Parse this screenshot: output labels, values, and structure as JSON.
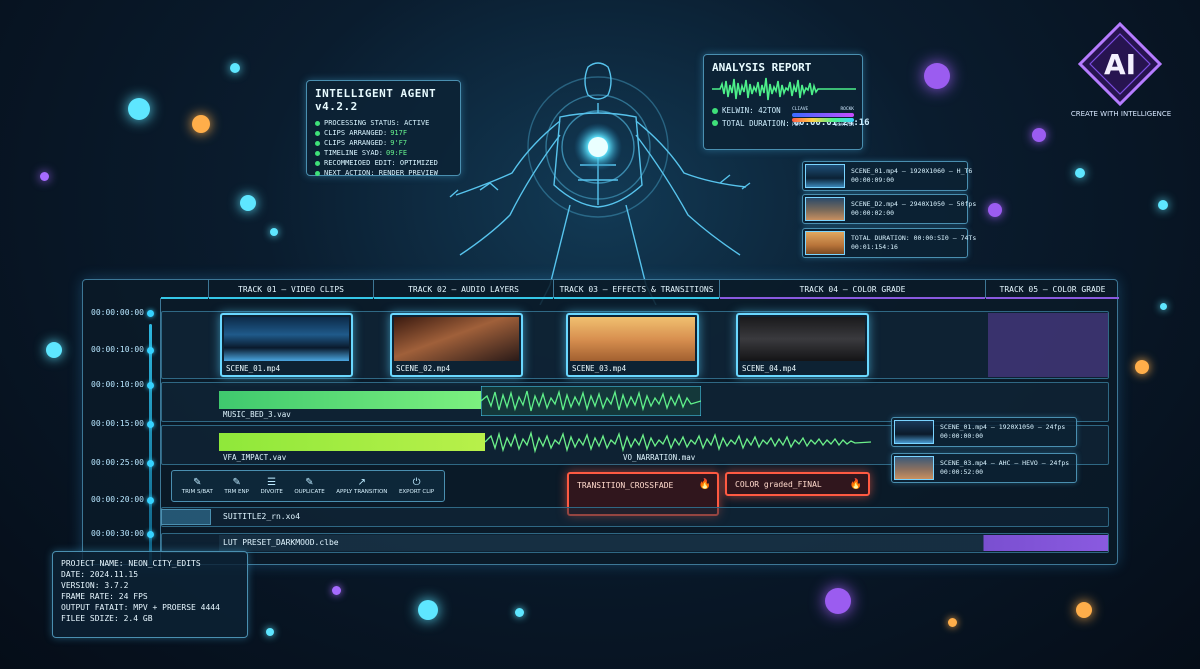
{
  "brand": {
    "logo_text": "AI",
    "tagline": "CREATE WITH INTELLIGENCE",
    "accent": "#9b5cf0"
  },
  "agent": {
    "title": "INTELLIGENT AGENT v4.2.2",
    "rows": [
      {
        "label": "PROCESSING STATUS: ACTIVE",
        "value": ""
      },
      {
        "label": "CLIPS ARRANGED:",
        "value": "917F"
      },
      {
        "label": "CLIPS ARRANGED:",
        "value": "9'F7"
      },
      {
        "label": "TIMELINE SYAD:",
        "value": "09:FE"
      },
      {
        "label": "RECOMMEIOED EDIT: OPTIMIZED",
        "value": ""
      },
      {
        "label": "NEXT ACTION: RENDER PREVIEW",
        "value": ""
      }
    ]
  },
  "analysis": {
    "title": "ANALYSIS REPORT",
    "meter_left": "CLIAVE",
    "meter_right": "ROCKK",
    "meter_left2": "PIM",
    "meter_right2": "DSATION",
    "kelvin": "KELWIN: 42TON",
    "duration_label": "TOTAL DURATION:",
    "duration_value": "00:00:01:24:16"
  },
  "side_clips": [
    {
      "line1": "SCENE_01.mp4 – 1920X1060 – H_T6",
      "line2": "00:00:09:00"
    },
    {
      "line1": "SCENE_D2.mp4 – 2940X1050 – 50fps",
      "line2": "00:00:02:00"
    },
    {
      "line1": "TOTAL DURATION: 00:00:SI0 – 74Ts",
      "line2": "00:01:154:16"
    }
  ],
  "right_clips": [
    {
      "line1": "SCENE_01.mp4 – 1920X1050 – 24fps",
      "line2": "00:00:00:00"
    },
    {
      "line1": "SCENE_03.mp4 – AHC – HEVO – 24fps",
      "line2": "00:00:52:00"
    }
  ],
  "tracks": {
    "headers": [
      "TRACK 01 – VIDEO CLIPS",
      "TRACK 02 – AUDIO LAYERS",
      "TRACK 03 – EFFECTS & TRANSITIONS",
      "TRACK 04 – COLOR GRADE",
      "TRACK 05 – COLOR GRADE"
    ]
  },
  "times": [
    "00:00:00:00",
    "00:00:10:00",
    "00:00:10:00",
    "00:00:15:00",
    "00:00:25:00",
    "00:00:20:00",
    "00:00:30:00"
  ],
  "video_clips": [
    "SCENE_01.mp4",
    "SCENE_02.mp4",
    "SCENE_03.mp4",
    "SCENE_04.mp4"
  ],
  "audio": {
    "music": "MUSIC_BED_3.vav",
    "sfx": "VFA_IMPACT.vav",
    "vo": "VO_NARRATION.mav"
  },
  "toolbar": [
    {
      "icon": "✎",
      "label": "TRIM S/BAT"
    },
    {
      "icon": "✎",
      "label": "TRM ENP"
    },
    {
      "icon": "☰",
      "label": "DIVOITE"
    },
    {
      "icon": "✎",
      "label": "OUPLICATE"
    },
    {
      "icon": "↗",
      "label": "APPLY TRANSITION"
    },
    {
      "icon": "⏻",
      "label": "EXPORT CLIP"
    }
  ],
  "effects": {
    "transition": "TRANSITION_CROSSFADE",
    "color": "COLOR graded_FINAL"
  },
  "subtitle": "SUITITLE2_rn.xo4",
  "lut": "LUT PRESET_DARKMOOD.clbe",
  "project": {
    "rows": [
      "PROJECT NAME: NEON_CITY_EDITS",
      "DATE: 2024.11.15",
      "VERSION: 3.7.2",
      "FRAME RATE: 24 FPS",
      "OUTPUT FATAIT: MPV + PROERSE 4444",
      "FILEE SDIZE: 2.4 GB"
    ]
  }
}
